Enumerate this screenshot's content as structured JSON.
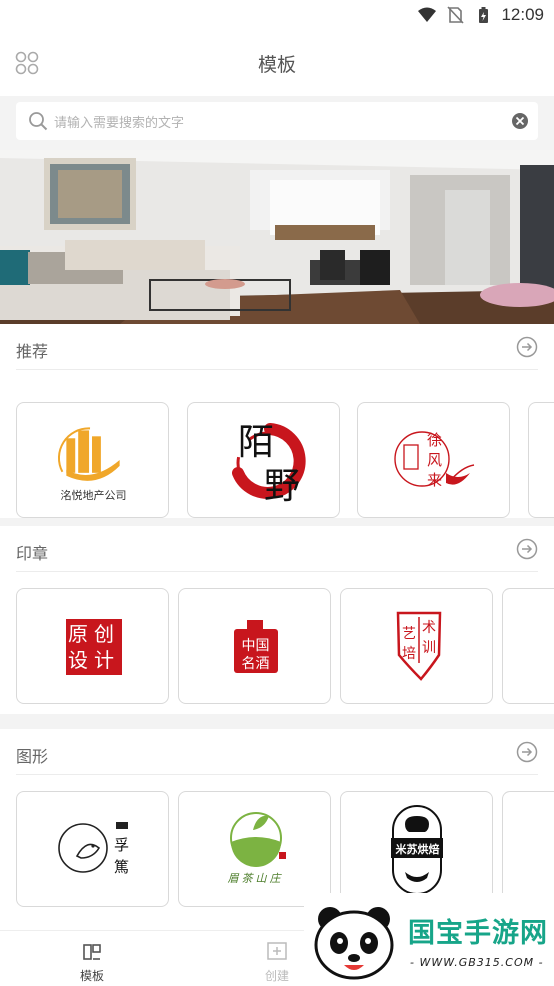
{
  "status_bar": {
    "time": "12:09"
  },
  "header": {
    "title": "模板"
  },
  "search": {
    "placeholder": "请输入需要搜索的文字"
  },
  "sections": {
    "recommend": {
      "title": "推荐",
      "cards": [
        {
          "text": "洺悦地产公司"
        },
        {
          "text_top": "陌",
          "text_bottom": "野"
        },
        {
          "chars": [
            "徐",
            "风",
            "来"
          ]
        }
      ]
    },
    "seal": {
      "title": "印章",
      "cards": [
        {
          "chars": [
            "原",
            "创",
            "设",
            "计"
          ]
        },
        {
          "line1": "中国",
          "line2": "名酒"
        },
        {
          "chars": [
            "艺",
            "术",
            "培",
            "训"
          ]
        }
      ]
    },
    "graphic": {
      "title": "图形",
      "cards": [
        {
          "chars": [
            "孚",
            "篤"
          ]
        },
        {
          "text": "眉茶山庄"
        },
        {
          "text": "米苏烘焙"
        }
      ]
    }
  },
  "bottom_nav": {
    "items": [
      {
        "label": "模板"
      },
      {
        "label": "创建"
      }
    ]
  },
  "watermark": {
    "title": "国宝手游网",
    "url": "- WWW.GB315.COM -"
  },
  "colors": {
    "accent_green": "#17a589",
    "seal_red": "#c8161d",
    "logo_orange": "#f0a72a"
  }
}
